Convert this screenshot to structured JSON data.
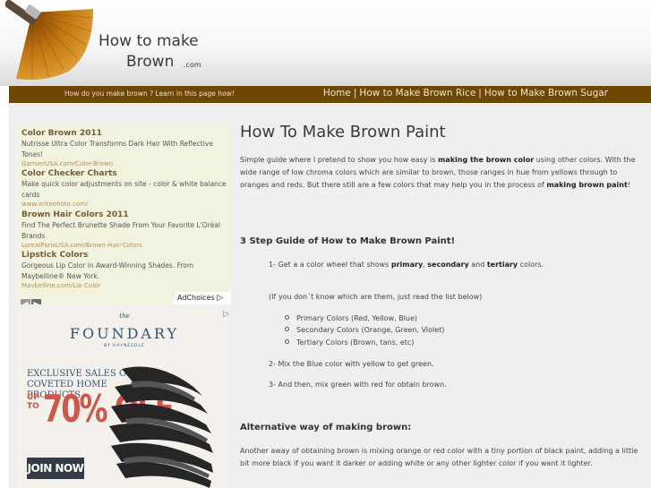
{
  "header": {
    "title_line1": "How to make",
    "title_line2": "Brown",
    "title_suffix": ".com"
  },
  "nav": {
    "tagline": "How do you make brown ? Learn in this page how!",
    "links": [
      "Home",
      "How to Make Brown Rice",
      "How to Make Brown Sugar"
    ],
    "separator": "|"
  },
  "ads": {
    "items": [
      {
        "title": "Color Brown 2011",
        "desc": "Nutrisse Ultra Color Transforms Dark Hair With Reflective Tones!",
        "url": "GarnierUSA.com/Color-Brown"
      },
      {
        "title": "Color Checker Charts",
        "desc": "Make quick color adjustments on site - color & white balance cards",
        "url": "www.xritephoto.com/"
      },
      {
        "title": "Brown Hair Colors 2011",
        "desc": "Find The Perfect Brunette Shade From Your Favorite L'Oréal Brands",
        "url": "LorealParisUSA.com/Brown-Hair-Colors"
      },
      {
        "title": "Lipstick Colors",
        "desc": "Gorgeous Lip Color in Award-Winning Shades. From Maybelline® New York.",
        "url": "Maybelline.com/Lip-Color"
      }
    ],
    "prev_icon": "chevron-left-icon",
    "next_icon": "chevron-right-icon",
    "adchoices_label": "AdChoices"
  },
  "banner": {
    "the": "the",
    "brand": "FOUNDARY",
    "by": "BY HAYNEEDLE",
    "headline": "EXCLUSIVE SALES ON COVETED HOME PRODUCTS",
    "upto": "UP TO",
    "percent": "70% OFF",
    "cta": "JOIN NOW"
  },
  "article": {
    "title": "How To Make Brown Paint",
    "intro_a": "Simple guide where I pretend to show you how easy is ",
    "intro_b": "making the brown color",
    "intro_c": " using other colors. With the wide range of low chroma colors which are similar to brown, those ranges in hue from yellows through to oranges and reds. But there still are a few colors that may help you in the process of ",
    "intro_d": "making brown paint",
    "intro_e": "!",
    "guide_heading": "3 Step Guide of How to Make Brown Paint!",
    "step1_a": "1- Get a a color wheel that shows ",
    "step1_b": "primary",
    "step1_c": ", ",
    "step1_d": "secondary",
    "step1_e": " and ",
    "step1_f": "tertiary",
    "step1_g": " colors.",
    "step1_note": "(If you don´t know which are them, just read the list below)",
    "colors": [
      "Primary Colors (Red, Yellow, Blue)",
      "Secondary Colors (Orange, Green, Violet)",
      "Tertiary Colors (Brown, tans, etc)"
    ],
    "step2": "2- Mix the Blue color with yellow to get green.",
    "step3": "3- And then, mix green with red for obtain brown.",
    "alt_heading": "Alternative way of making brown:",
    "alt_text": "Another away of obtaining brown is mixing orange or red color with a tiny portion of black paint, adding a little bit more black if you want it darker or adding white or any other lighter color if you want it lighter."
  },
  "colors": {
    "navbar": "#6e4705",
    "accent_text": "#7a5a30",
    "banner_red": "#d2554a",
    "banner_blue": "#2f5670"
  }
}
